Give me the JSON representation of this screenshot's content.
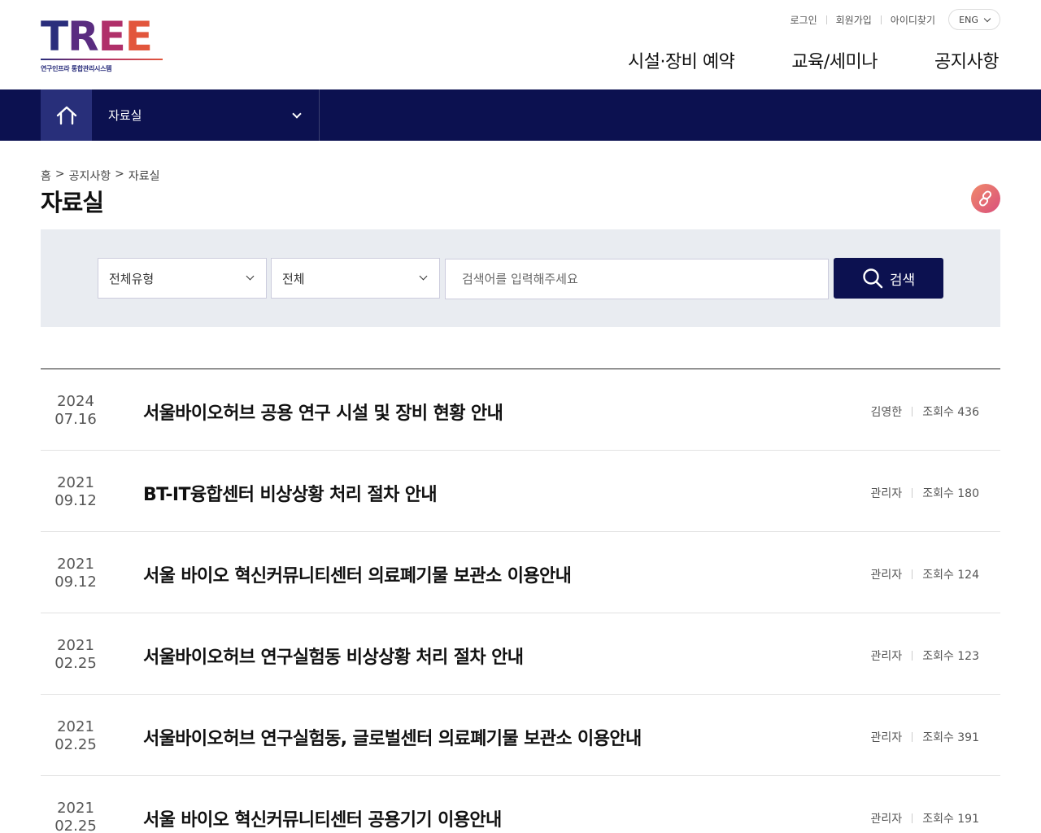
{
  "logo": {
    "letters": [
      "T",
      "R",
      "E",
      "E"
    ],
    "subtitle": "연구인프라 통합관리시스템"
  },
  "util": {
    "login": "로그인",
    "join": "회원가입",
    "find_id": "아이디찾기",
    "lang": "ENG"
  },
  "gnb": [
    "시설·장비 예약",
    "교육/세미나",
    "공지사항"
  ],
  "subnav": {
    "home_icon": "home-icon",
    "depth_label": "자료실"
  },
  "breadcrumb": [
    "홈",
    ">",
    "공지사항",
    ">",
    "자료실"
  ],
  "page_title": "자료실",
  "search": {
    "type_select": "전체유형",
    "field_select": "전체",
    "placeholder": "검색어를 입력해주세요",
    "button_label": "검색"
  },
  "posts": [
    {
      "year": "2024",
      "date": "07.16",
      "title": "서울바이오허브 공용 연구 시설 및 장비 현황 안내",
      "author": "김영한",
      "views": "조회수 436"
    },
    {
      "year": "2021",
      "date": "09.12",
      "title": "BT-IT융합센터 비상상황 처리 절차 안내",
      "author": "관리자",
      "views": "조회수 180"
    },
    {
      "year": "2021",
      "date": "09.12",
      "title": "서울 바이오 혁신커뮤니티센터 의료폐기물 보관소 이용안내",
      "author": "관리자",
      "views": "조회수 124"
    },
    {
      "year": "2021",
      "date": "02.25",
      "title": "서울바이오허브 연구실험동 비상상황 처리 절차 안내",
      "author": "관리자",
      "views": "조회수 123"
    },
    {
      "year": "2021",
      "date": "02.25",
      "title": "서울바이오허브 연구실험동, 글로벌센터 의료폐기물 보관소 이용안내",
      "author": "관리자",
      "views": "조회수 391"
    },
    {
      "year": "2021",
      "date": "02.25",
      "title": "서울 바이오 혁신커뮤니티센터 공용기기 이용안내",
      "author": "관리자",
      "views": "조회수 191"
    }
  ],
  "colors": {
    "navy": "#0c1150",
    "home_bg": "#282f7a",
    "search_bg": "#e9ecf1",
    "accent_gradient_start": "#f08a6a",
    "accent_gradient_end": "#d94f7c"
  }
}
